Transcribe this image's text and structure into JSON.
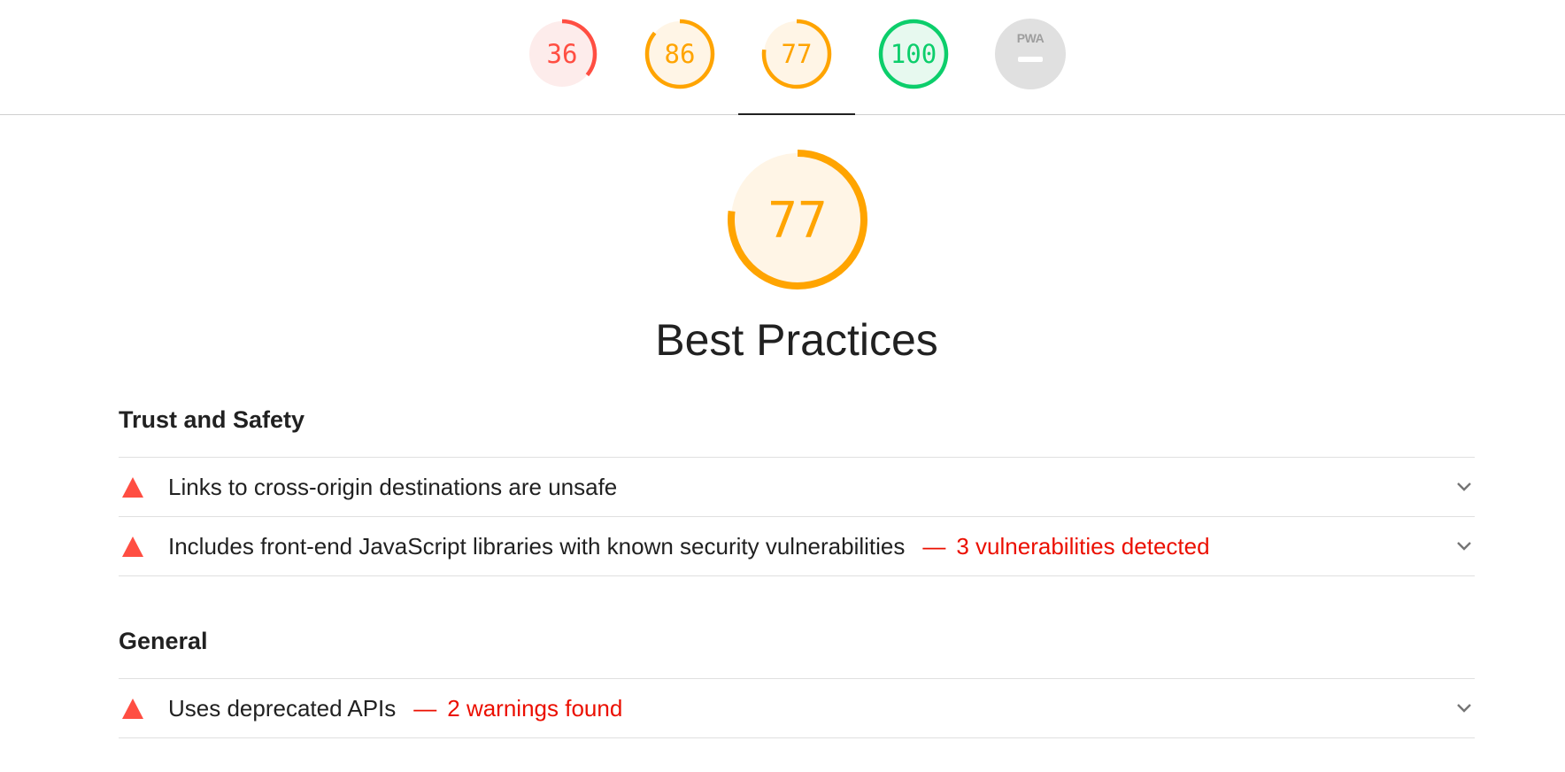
{
  "gauges": [
    {
      "label": "36",
      "score": 0.36,
      "color": "#ff4e42",
      "bg": "#fdeceb"
    },
    {
      "label": "86",
      "score": 0.86,
      "color": "#ffa400",
      "bg": "#fff5e6"
    },
    {
      "label": "77",
      "score": 0.77,
      "color": "#ffa400",
      "bg": "#fff5e6"
    },
    {
      "label": "100",
      "score": 1.0,
      "color": "#0cce6b",
      "bg": "#e7f9ef"
    }
  ],
  "pwa": {
    "label": "PWA"
  },
  "main": {
    "score_label": "77",
    "score": 0.77,
    "color": "#ffa400",
    "bg": "#fff5e6",
    "title": "Best Practices"
  },
  "groups": [
    {
      "title": "Trust and Safety",
      "audits": [
        {
          "title": "Links to cross-origin destinations are unsafe",
          "display": "",
          "separator": ""
        },
        {
          "title": "Includes front-end JavaScript libraries with known security vulnerabilities",
          "display": "3 vulnerabilities detected",
          "separator": "—"
        }
      ]
    },
    {
      "title": "General",
      "audits": [
        {
          "title": "Uses deprecated APIs",
          "display": "2 warnings found",
          "separator": "—"
        }
      ]
    }
  ],
  "icons": {
    "fail": "warning-triangle-icon",
    "expand": "chevron-down-icon"
  }
}
